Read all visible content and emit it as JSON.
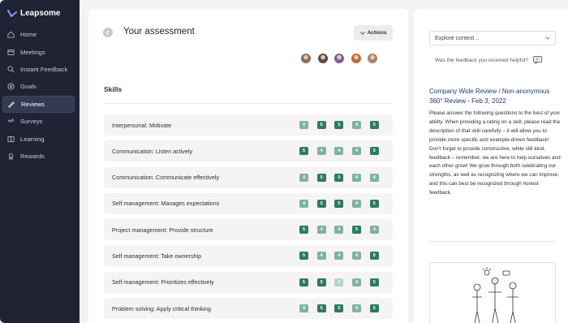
{
  "app": {
    "brand": "Leapsome"
  },
  "sidebar": {
    "items": [
      {
        "label": "Home",
        "icon": "home-icon",
        "active": false
      },
      {
        "label": "Meetings",
        "icon": "meetings-icon",
        "active": false
      },
      {
        "label": "Instant Feedback",
        "icon": "feedback-icon",
        "active": false
      },
      {
        "label": "Goals",
        "icon": "goals-icon",
        "active": false
      },
      {
        "label": "Reviews",
        "icon": "reviews-icon",
        "active": true
      },
      {
        "label": "Surveys",
        "icon": "surveys-icon",
        "active": false
      },
      {
        "label": "Learning",
        "icon": "learning-icon",
        "active": false
      },
      {
        "label": "Rewards",
        "icon": "rewards-icon",
        "active": false
      }
    ]
  },
  "main": {
    "title": "Your assessment",
    "actions_label": "Actions",
    "skills_heading": "Skills",
    "reviewer_colors": [
      "#8a6f5c",
      "#5a4b46",
      "#7b5f9e",
      "#c0683a",
      "#a8826c"
    ],
    "rows": [
      {
        "label": "Interpersonal: Motivate",
        "scores": [
          "4",
          "5",
          "5",
          "4",
          "5"
        ],
        "faded": [
          true,
          false,
          false,
          true,
          false
        ]
      },
      {
        "label": "Communication: Listen actively",
        "scores": [
          "5",
          "4",
          "4",
          "4",
          "5"
        ],
        "faded": [
          false,
          true,
          true,
          true,
          false
        ]
      },
      {
        "label": "Communication: Communicate effectively",
        "scores": [
          "4",
          "5",
          "5",
          "4",
          "4"
        ],
        "faded": [
          true,
          false,
          false,
          true,
          true
        ]
      },
      {
        "label": "Self management: Manages expectations",
        "scores": [
          "4",
          "5",
          "5",
          "4",
          "5"
        ],
        "faded": [
          true,
          false,
          false,
          true,
          false
        ]
      },
      {
        "label": "Project management: Provide structure",
        "scores": [
          "5",
          "4",
          "4",
          "5",
          "4"
        ],
        "faded": [
          false,
          true,
          true,
          false,
          true
        ]
      },
      {
        "label": "Self management: Take ownership",
        "scores": [
          "5",
          "4",
          "4",
          "4",
          "5"
        ],
        "faded": [
          false,
          true,
          true,
          true,
          false
        ]
      },
      {
        "label": "Self management: Prioritizes effectively",
        "scores": [
          "5",
          "5",
          "2",
          "4",
          "5"
        ],
        "faded": [
          false,
          false,
          "light",
          true,
          false
        ]
      },
      {
        "label": "Problem solving: Apply critical thinking",
        "scores": [
          "4",
          "5",
          "5",
          "4",
          "5"
        ],
        "faded": [
          true,
          false,
          false,
          true,
          false
        ]
      }
    ]
  },
  "right_panel": {
    "context_placeholder": "Explore context ..",
    "helpful_question": "Was the feedback you received helpful?",
    "review_title": "Company Wide Review / Non-anonymous 360° Review - Feb 3, 2022",
    "review_description": "Please answer the following questions to the best of your ability. When providing a rating on a skill, please read the description of that skill carefully – it will allow you to provide more specific and example-driven feedback! Don't forget to provide constructive, while still kind, feedback – remember, we are here to help ourselves and each other grow! We grow through both celebrating our strengths, as well as recognizing where we can improve, and this can best be recognized through honest feedback."
  },
  "colors": {
    "sidebar_bg": "#1f2333",
    "score_dark": "#2e7a62",
    "score_light": "#7fb3a1",
    "score_pale": "#b7d3c8",
    "review_title": "#1f3b70"
  }
}
